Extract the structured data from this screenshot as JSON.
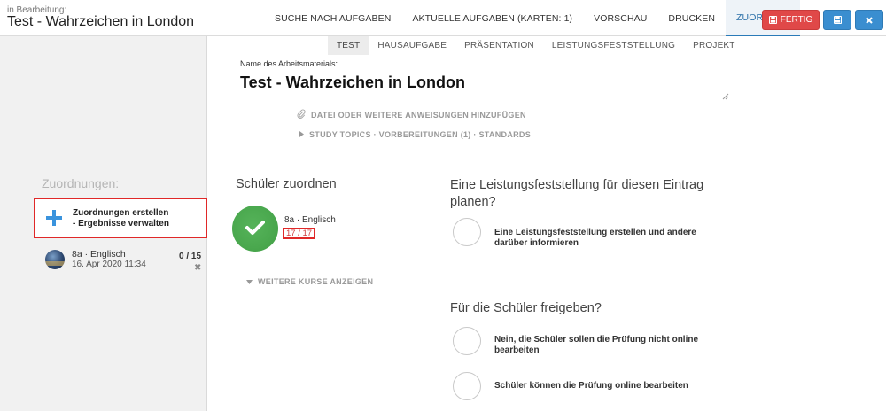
{
  "header": {
    "subtitle": "in Bearbeitung:",
    "title": "Test - Wahrzeichen in London",
    "tabs": [
      {
        "label": "SUCHE NACH AUFGABEN"
      },
      {
        "label": "AKTUELLE AUFGABEN (KARTEN: 1)"
      },
      {
        "label": "VORSCHAU"
      },
      {
        "label": "DRUCKEN"
      },
      {
        "label": "ZUORDNEN"
      }
    ],
    "active_tab": "ZUORDNEN",
    "finish_label": "FERTIG",
    "colors": {
      "finish": "#e04848",
      "primary": "#3a8ed0"
    }
  },
  "sidebar": {
    "heading": "Zuordnungen:",
    "create_line1": "Zuordnungen erstellen",
    "create_line2": "- Ergebnisse verwalten",
    "course": {
      "name": "8a · Englisch",
      "date": "16. Apr 2020 11:34",
      "count": "0 / 15"
    }
  },
  "type_tabs": [
    "TEST",
    "HAUSAUFGABE",
    "PRÄSENTATION",
    "LEISTUNGSFESTSTELLUNG",
    "PROJEKT"
  ],
  "active_type": "TEST",
  "material": {
    "label": "Name des Arbeitsmaterials:",
    "value": "Test - Wahrzeichen in London"
  },
  "options": {
    "attach": "DATEI ODER WEITERE ANWEISUNGEN HINZUFÜGEN",
    "topics": "STUDY TOPICS · VORBEREITUNGEN (1) · STANDARDS"
  },
  "assign": {
    "title": "Schüler zuordnen",
    "course": "8a · Englisch",
    "count": "17 / 17",
    "more_courses": "WEITERE KURSE ANZEIGEN",
    "color": "#4aa84e"
  },
  "assessment": {
    "title": "Eine Leistungsfeststellung für diesen Eintrag planen?",
    "option": "Eine Leistungsfeststellung erstellen und andere darüber informieren"
  },
  "release": {
    "title": "Für die Schüler freigeben?",
    "option_no": "Nein, die Schüler sollen die Prüfung nicht online bearbeiten",
    "option_yes": "Schüler können die Prüfung online bearbeiten"
  }
}
